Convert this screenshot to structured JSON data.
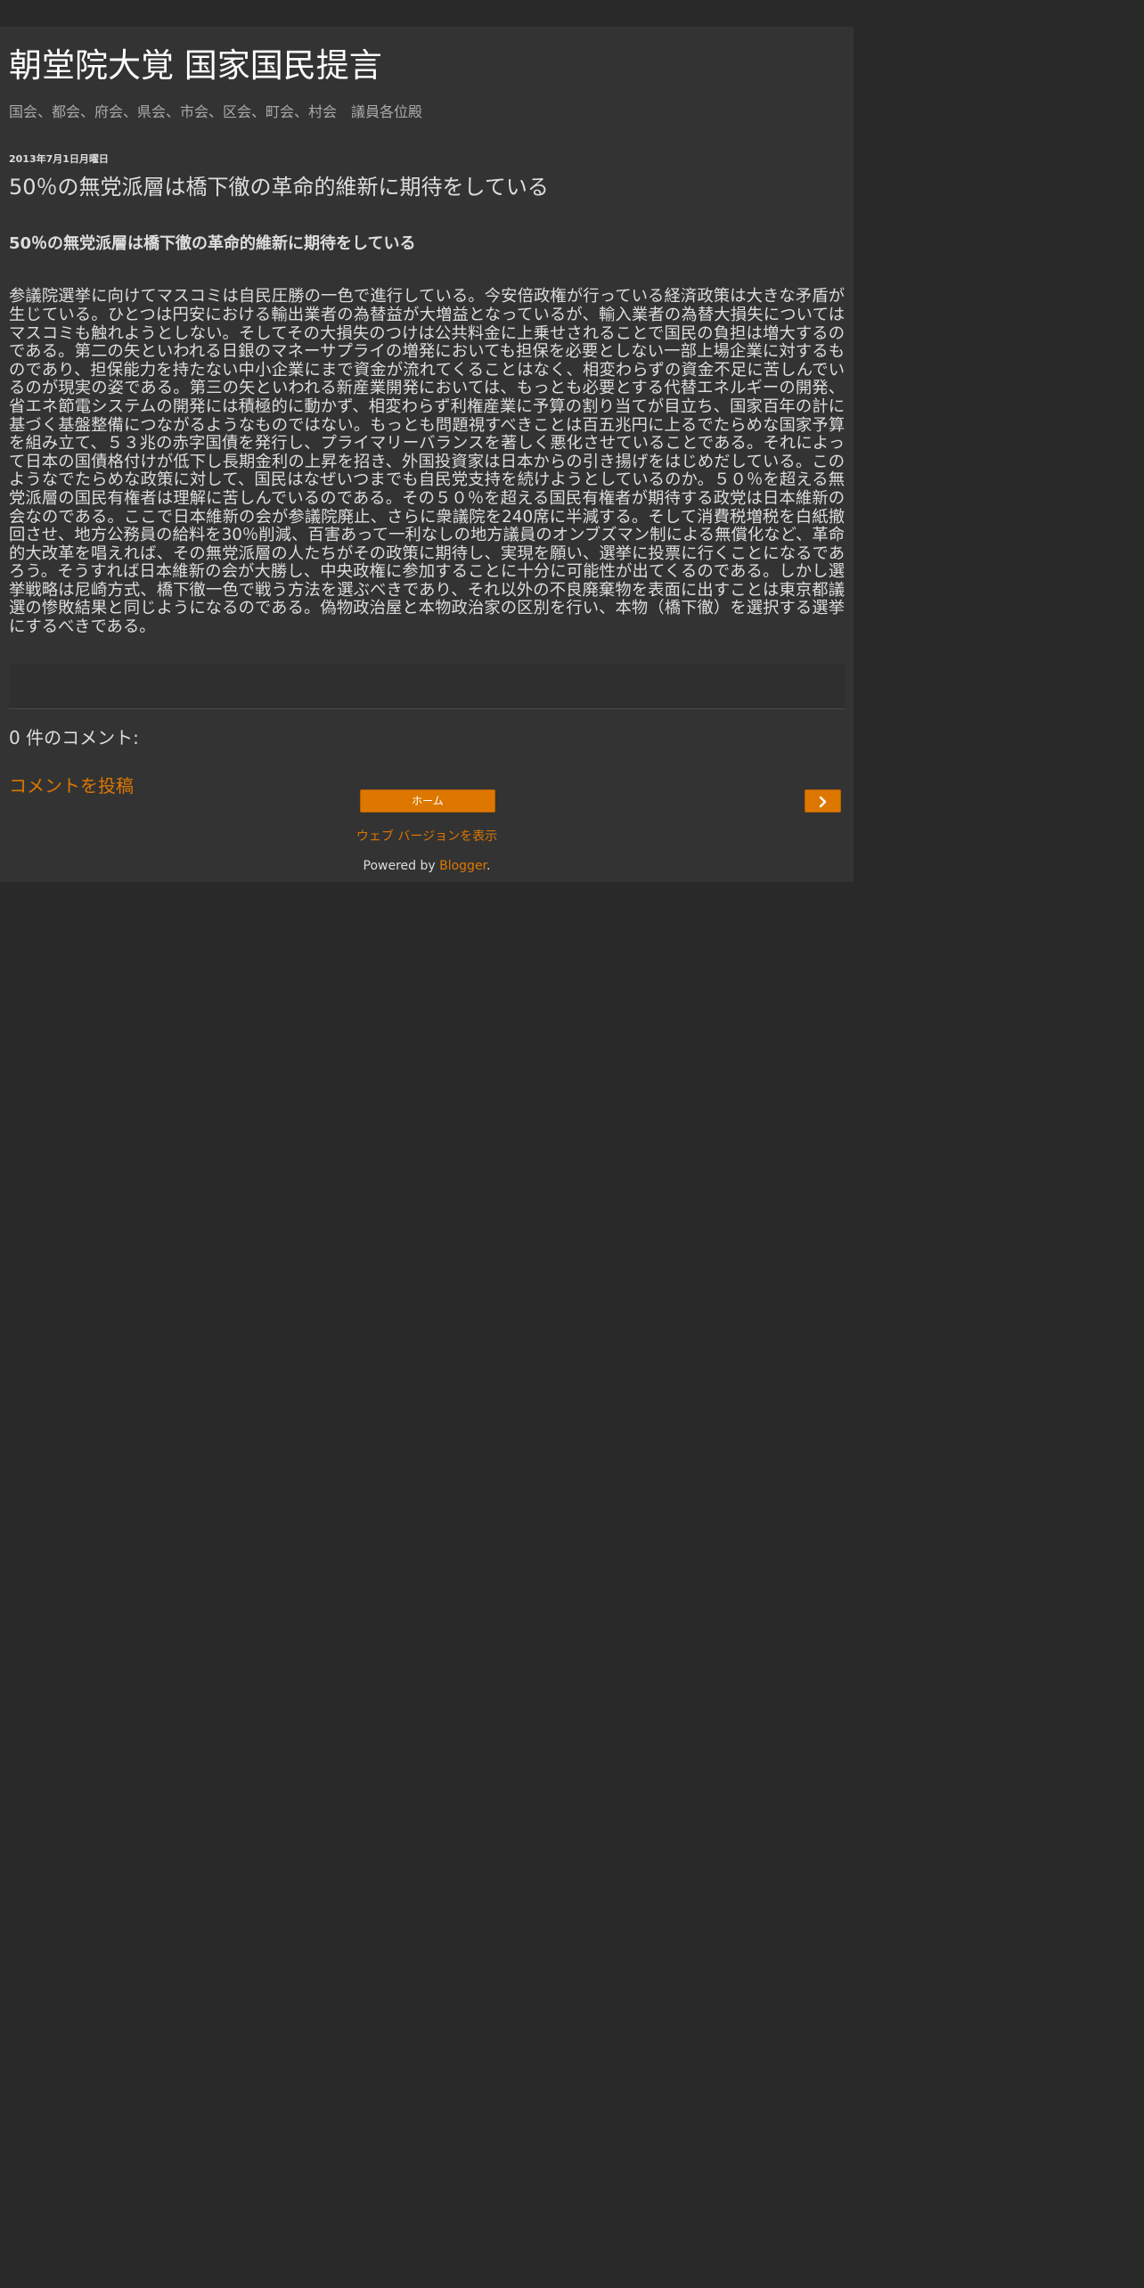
{
  "header": {
    "title": "朝堂院大覚 国家国民提言",
    "description": "国会、都会、府会、県会、市会、区会、町会、村会　議員各位殿"
  },
  "post": {
    "date": "2013年7月1日月曜日",
    "title": "50％の無党派層は橋下徹の革命的維新に期待をしている",
    "subtitle": "50％の無党派層は橋下徹の革命的維新に期待をしている",
    "body": "参議院選挙に向けてマスコミは自民圧勝の一色で進行している。今安倍政権が行っている経済政策は大きな矛盾が生じている。ひとつは円安における輸出業者の為替益が大増益となっているが、輸入業者の為替大損失についてはマスコミも触れようとしない。そしてその大損失のつけは公共料金に上乗せされることで国民の負担は増大するのである。第二の矢といわれる日銀のマネーサプライの増発においても担保を必要としない一部上場企業に対するものであり、担保能力を持たない中小企業にまで資金が流れてくることはなく、相変わらずの資金不足に苦しんでいるのが現実の姿である。第三の矢といわれる新産業開発においては、もっとも必要とする代替エネルギーの開発、省エネ節電システムの開発には積極的に動かず、相変わらず利権産業に予算の割り当てが目立ち、国家百年の計に基づく基盤整備につながるようなものではない。もっとも問題視すべきことは百五兆円に上るでたらめな国家予算を組み立て、５３兆の赤字国債を発行し、プライマリーバランスを著しく悪化させていることである。それによって日本の国債格付けが低下し長期金利の上昇を招き、外国投資家は日本からの引き揚げをはじめだしている。このようなでたらめな政策に対して、国民はなぜいつまでも自民党支持を続けようとしているのか。５０％を超える無党派層の国民有権者は理解に苦しんでいるのである。その５０％を超える国民有権者が期待する政党は日本維新の会なのである。ここで日本維新の会が参議院廃止、さらに衆議院を240席に半減する。そして消費税増税を白紙撤回させ、地方公務員の給料を30％削減、百害あって一利なしの地方議員のオンブズマン制による無償化など、革命的大改革を唱えれば、その無党派層の人たちがその政策に期待し、実現を願い、選挙に投票に行くことになるであろう。そうすれば日本維新の会が大勝し、中央政権に参加することに十分に可能性が出てくるのである。しかし選挙戦略は尼崎方式、橋下徹一色で戦う方法を選ぶべきであり、それ以外の不良廃棄物を表面に出すことは東京都議選の惨敗結果と同じようになるのである。偽物政治屋と本物政治家の区別を行い、本物（橋下徹）を選択する選挙にするべきである。"
  },
  "comments": {
    "title": "0 件のコメント:",
    "post_link": "コメントを投稿"
  },
  "nav": {
    "home_label": "ホーム",
    "next_icon": "chevron-right-icon"
  },
  "footer": {
    "web_version": "ウェブ バージョンを表示",
    "powered_prefix": "Powered by ",
    "powered_link": "Blogger",
    "powered_suffix": "."
  },
  "colors": {
    "background": "#292929",
    "content_background": "#333333",
    "accent": "#dd7700",
    "text": "#dddddd",
    "title": "#ffffff"
  }
}
